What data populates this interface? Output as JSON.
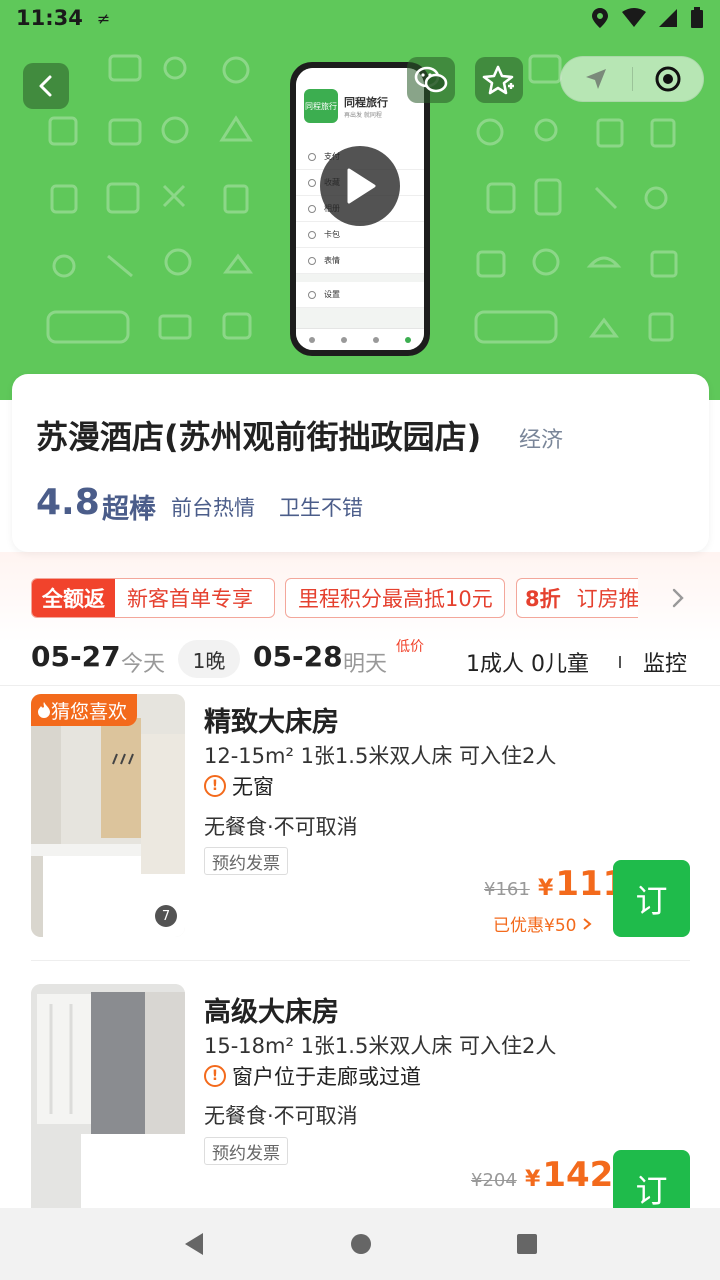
{
  "status_bar": {
    "time": "11:34",
    "indicator": "≠"
  },
  "header": {
    "back_icon": "chevron-left-icon",
    "share_icon": "wechat-share-icon",
    "favorite_icon": "star-plus-icon",
    "capsule": [
      "location-arrow-icon",
      "record-icon"
    ]
  },
  "video_preview": {
    "app_name": "同程旅行",
    "app_sub": "再出发 就同程",
    "logo_text": "同程旅行",
    "menu": [
      "支付",
      "收藏",
      "相册",
      "卡包",
      "表情",
      "设置"
    ]
  },
  "hotel": {
    "name": "苏漫酒店(苏州观前街拙政园店)",
    "tag": "经济",
    "score": "4.8",
    "score_word": "超棒",
    "highlights": [
      "前台热情",
      "卫生不错"
    ]
  },
  "promos": {
    "p1_fill": "全额返",
    "p1_text": "新客首单专享",
    "p2_text": "里程积分最高抵10元",
    "p3_fill": "8折",
    "p3_text": "订房推"
  },
  "dates": {
    "checkin": "05-27",
    "checkin_label": "今天",
    "nights": "1晚",
    "checkout": "05-28",
    "checkout_label": "明天",
    "low_price": "低价",
    "guests": "1成人 0儿童",
    "monitor": "监控"
  },
  "rooms": [
    {
      "badge": "猜您喜欢",
      "title": "精致大床房",
      "spec": "12-15m²  1张1.5米双人床  可入住2人",
      "warning": "无窗",
      "policy": "无餐食·不可取消",
      "invoice": "预约发票",
      "image_count": "7",
      "orig_price": "¥161",
      "currency": "¥",
      "price": "111",
      "discount": "已优惠¥50",
      "book": "订"
    },
    {
      "badge": "",
      "title": "高级大床房",
      "spec": "15-18m²  1张1.5米双人床  可入住2人",
      "warning": "窗户位于走廊或过道",
      "policy": "无餐食·不可取消",
      "invoice": "预约发票",
      "image_count": "",
      "orig_price": "¥204",
      "currency": "¥",
      "price": "142",
      "discount": "",
      "book": "订"
    }
  ],
  "colors": {
    "banner": "#5fc85a",
    "brand_green": "#1fbb4b",
    "price_orange": "#f36a1c",
    "promo_red": "#f1432c",
    "rating_blue": "#4b5d8a"
  }
}
